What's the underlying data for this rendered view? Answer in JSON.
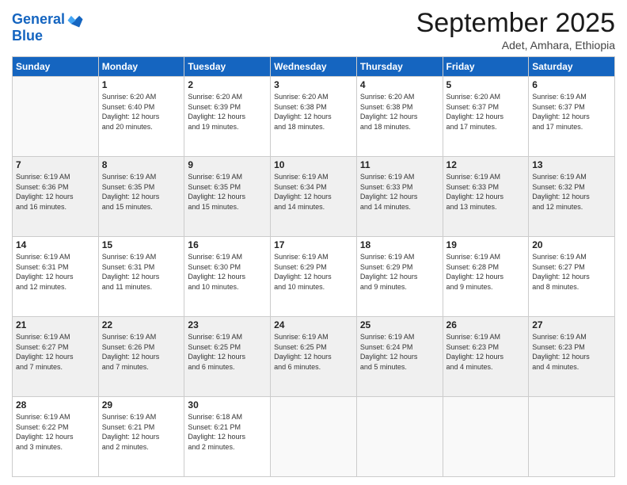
{
  "header": {
    "logo_line1": "General",
    "logo_line2": "Blue",
    "month": "September 2025",
    "location": "Adet, Amhara, Ethiopia"
  },
  "weekdays": [
    "Sunday",
    "Monday",
    "Tuesday",
    "Wednesday",
    "Thursday",
    "Friday",
    "Saturday"
  ],
  "weeks": [
    [
      {
        "num": "",
        "info": ""
      },
      {
        "num": "1",
        "info": "Sunrise: 6:20 AM\nSunset: 6:40 PM\nDaylight: 12 hours\nand 20 minutes."
      },
      {
        "num": "2",
        "info": "Sunrise: 6:20 AM\nSunset: 6:39 PM\nDaylight: 12 hours\nand 19 minutes."
      },
      {
        "num": "3",
        "info": "Sunrise: 6:20 AM\nSunset: 6:38 PM\nDaylight: 12 hours\nand 18 minutes."
      },
      {
        "num": "4",
        "info": "Sunrise: 6:20 AM\nSunset: 6:38 PM\nDaylight: 12 hours\nand 18 minutes."
      },
      {
        "num": "5",
        "info": "Sunrise: 6:20 AM\nSunset: 6:37 PM\nDaylight: 12 hours\nand 17 minutes."
      },
      {
        "num": "6",
        "info": "Sunrise: 6:19 AM\nSunset: 6:37 PM\nDaylight: 12 hours\nand 17 minutes."
      }
    ],
    [
      {
        "num": "7",
        "info": "Sunrise: 6:19 AM\nSunset: 6:36 PM\nDaylight: 12 hours\nand 16 minutes."
      },
      {
        "num": "8",
        "info": "Sunrise: 6:19 AM\nSunset: 6:35 PM\nDaylight: 12 hours\nand 15 minutes."
      },
      {
        "num": "9",
        "info": "Sunrise: 6:19 AM\nSunset: 6:35 PM\nDaylight: 12 hours\nand 15 minutes."
      },
      {
        "num": "10",
        "info": "Sunrise: 6:19 AM\nSunset: 6:34 PM\nDaylight: 12 hours\nand 14 minutes."
      },
      {
        "num": "11",
        "info": "Sunrise: 6:19 AM\nSunset: 6:33 PM\nDaylight: 12 hours\nand 14 minutes."
      },
      {
        "num": "12",
        "info": "Sunrise: 6:19 AM\nSunset: 6:33 PM\nDaylight: 12 hours\nand 13 minutes."
      },
      {
        "num": "13",
        "info": "Sunrise: 6:19 AM\nSunset: 6:32 PM\nDaylight: 12 hours\nand 12 minutes."
      }
    ],
    [
      {
        "num": "14",
        "info": "Sunrise: 6:19 AM\nSunset: 6:31 PM\nDaylight: 12 hours\nand 12 minutes."
      },
      {
        "num": "15",
        "info": "Sunrise: 6:19 AM\nSunset: 6:31 PM\nDaylight: 12 hours\nand 11 minutes."
      },
      {
        "num": "16",
        "info": "Sunrise: 6:19 AM\nSunset: 6:30 PM\nDaylight: 12 hours\nand 10 minutes."
      },
      {
        "num": "17",
        "info": "Sunrise: 6:19 AM\nSunset: 6:29 PM\nDaylight: 12 hours\nand 10 minutes."
      },
      {
        "num": "18",
        "info": "Sunrise: 6:19 AM\nSunset: 6:29 PM\nDaylight: 12 hours\nand 9 minutes."
      },
      {
        "num": "19",
        "info": "Sunrise: 6:19 AM\nSunset: 6:28 PM\nDaylight: 12 hours\nand 9 minutes."
      },
      {
        "num": "20",
        "info": "Sunrise: 6:19 AM\nSunset: 6:27 PM\nDaylight: 12 hours\nand 8 minutes."
      }
    ],
    [
      {
        "num": "21",
        "info": "Sunrise: 6:19 AM\nSunset: 6:27 PM\nDaylight: 12 hours\nand 7 minutes."
      },
      {
        "num": "22",
        "info": "Sunrise: 6:19 AM\nSunset: 6:26 PM\nDaylight: 12 hours\nand 7 minutes."
      },
      {
        "num": "23",
        "info": "Sunrise: 6:19 AM\nSunset: 6:25 PM\nDaylight: 12 hours\nand 6 minutes."
      },
      {
        "num": "24",
        "info": "Sunrise: 6:19 AM\nSunset: 6:25 PM\nDaylight: 12 hours\nand 6 minutes."
      },
      {
        "num": "25",
        "info": "Sunrise: 6:19 AM\nSunset: 6:24 PM\nDaylight: 12 hours\nand 5 minutes."
      },
      {
        "num": "26",
        "info": "Sunrise: 6:19 AM\nSunset: 6:23 PM\nDaylight: 12 hours\nand 4 minutes."
      },
      {
        "num": "27",
        "info": "Sunrise: 6:19 AM\nSunset: 6:23 PM\nDaylight: 12 hours\nand 4 minutes."
      }
    ],
    [
      {
        "num": "28",
        "info": "Sunrise: 6:19 AM\nSunset: 6:22 PM\nDaylight: 12 hours\nand 3 minutes."
      },
      {
        "num": "29",
        "info": "Sunrise: 6:19 AM\nSunset: 6:21 PM\nDaylight: 12 hours\nand 2 minutes."
      },
      {
        "num": "30",
        "info": "Sunrise: 6:18 AM\nSunset: 6:21 PM\nDaylight: 12 hours\nand 2 minutes."
      },
      {
        "num": "",
        "info": ""
      },
      {
        "num": "",
        "info": ""
      },
      {
        "num": "",
        "info": ""
      },
      {
        "num": "",
        "info": ""
      }
    ]
  ]
}
